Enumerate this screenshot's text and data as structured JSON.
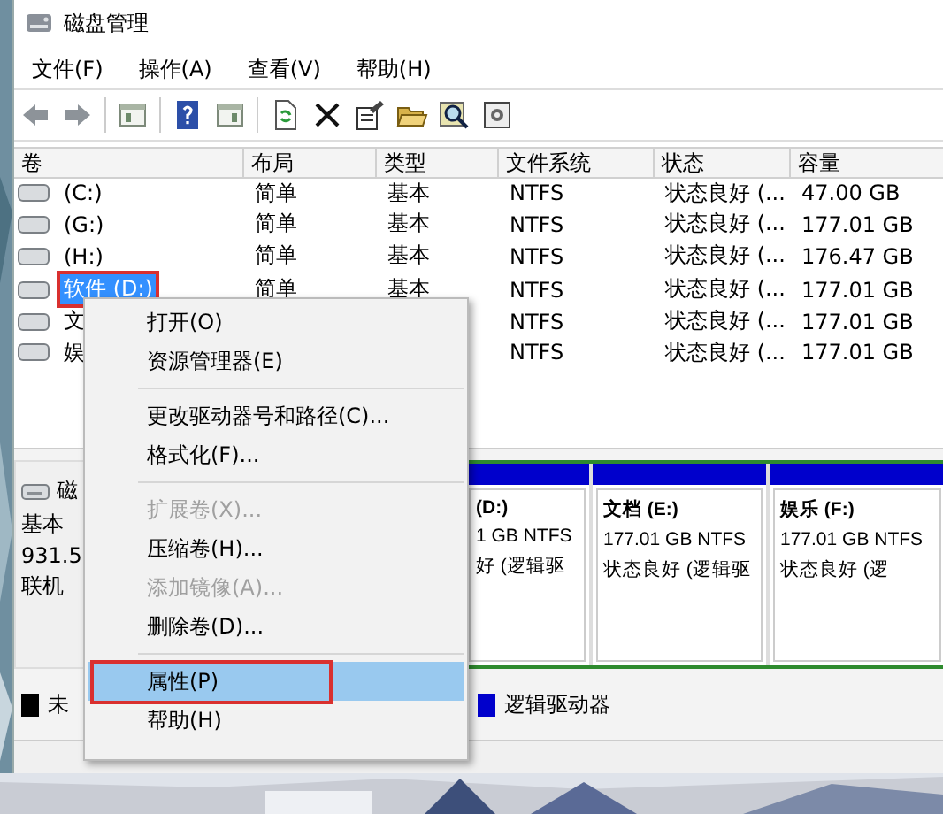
{
  "window": {
    "title": "磁盘管理"
  },
  "menu": [
    "文件(F)",
    "操作(A)",
    "查看(V)",
    "帮助(H)"
  ],
  "columns": [
    "卷",
    "布局",
    "类型",
    "文件系统",
    "状态",
    "容量"
  ],
  "volumes": [
    {
      "name": "(C:)",
      "layout": "简单",
      "type": "基本",
      "fs": "NTFS",
      "status": "状态良好 (...",
      "capacity": "47.00 GB",
      "selected": false,
      "annotated": false
    },
    {
      "name": "(G:)",
      "layout": "简单",
      "type": "基本",
      "fs": "NTFS",
      "status": "状态良好 (...",
      "capacity": "177.01 GB",
      "selected": false,
      "annotated": false
    },
    {
      "name": "(H:)",
      "layout": "简单",
      "type": "基本",
      "fs": "NTFS",
      "status": "状态良好 (...",
      "capacity": "176.47 GB",
      "selected": false,
      "annotated": false
    },
    {
      "name": "软件 (D:)",
      "layout": "简单",
      "type": "基本",
      "fs": "NTFS",
      "status": "状态良好 (...",
      "capacity": "177.01 GB",
      "selected": true,
      "annotated": true
    },
    {
      "name": "文",
      "fs": "NTFS",
      "status": "状态良好 (...",
      "capacity": "177.01 GB",
      "selected": false,
      "annotated": false
    },
    {
      "name": "娱",
      "fs": "NTFS",
      "status": "状态良好 (...",
      "capacity": "177.01 GB",
      "selected": false,
      "annotated": false
    }
  ],
  "disk": {
    "title": "磁",
    "kind": "基本",
    "size": "931.5",
    "state": "联机"
  },
  "partitions": [
    {
      "title": "(D:)",
      "size": "1 GB NTFS",
      "status": "好 (逻辑驱"
    },
    {
      "title": "文档 (E:)",
      "size": "177.01 GB NTFS",
      "status": "状态良好 (逻辑驱"
    },
    {
      "title": "娱乐 (F:)",
      "size": "177.01 GB NTFS",
      "status": "状态良好 (逻"
    }
  ],
  "legend": [
    {
      "label": "未",
      "color": "#000000"
    },
    {
      "label": "逻辑驱动器",
      "color": "#0000cc"
    }
  ],
  "context_menu": [
    {
      "kind": "item",
      "label": "打开(O)",
      "disabled": false,
      "selected": false,
      "annotated": false
    },
    {
      "kind": "item",
      "label": "资源管理器(E)",
      "disabled": false,
      "selected": false,
      "annotated": false
    },
    {
      "kind": "separator"
    },
    {
      "kind": "item",
      "label": "更改驱动器号和路径(C)...",
      "disabled": false,
      "selected": false,
      "annotated": false
    },
    {
      "kind": "item",
      "label": "格式化(F)...",
      "disabled": false,
      "selected": false,
      "annotated": false
    },
    {
      "kind": "separator"
    },
    {
      "kind": "item",
      "label": "扩展卷(X)...",
      "disabled": true,
      "selected": false,
      "annotated": false
    },
    {
      "kind": "item",
      "label": "压缩卷(H)...",
      "disabled": false,
      "selected": false,
      "annotated": false
    },
    {
      "kind": "item",
      "label": "添加镜像(A)...",
      "disabled": true,
      "selected": false,
      "annotated": false
    },
    {
      "kind": "item",
      "label": "删除卷(D)...",
      "disabled": false,
      "selected": false,
      "annotated": false
    },
    {
      "kind": "separator"
    },
    {
      "kind": "item",
      "label": "属性(P)",
      "disabled": false,
      "selected": true,
      "annotated": true
    },
    {
      "kind": "item",
      "label": "帮助(H)",
      "disabled": false,
      "selected": false,
      "annotated": false
    }
  ]
}
